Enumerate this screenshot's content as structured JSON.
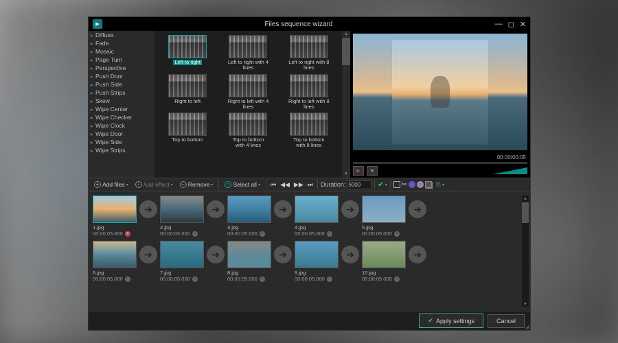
{
  "titlebar": {
    "title": "Files sequence wizard"
  },
  "sidebar": {
    "items": [
      {
        "label": "Diffuse"
      },
      {
        "label": "Fade"
      },
      {
        "label": "Mosaic"
      },
      {
        "label": "Page Turn"
      },
      {
        "label": "Perspective"
      },
      {
        "label": "Push Door"
      },
      {
        "label": "Push Side"
      },
      {
        "label": "Push Strips"
      },
      {
        "label": "Skew"
      },
      {
        "label": "Wipe Center"
      },
      {
        "label": "Wipe Checker"
      },
      {
        "label": "Wipe Clock"
      },
      {
        "label": "Wipe Door"
      },
      {
        "label": "Wipe Side"
      },
      {
        "label": "Wipe Strips"
      }
    ]
  },
  "transitions": [
    {
      "label": "Left to right",
      "highlighted": true
    },
    {
      "label": "Left to right with 4 lines"
    },
    {
      "label": "Left to right with 8 lines"
    },
    {
      "label": "Right to left"
    },
    {
      "label": "Right to left with 4 lines"
    },
    {
      "label": "Right to left with 8 lines"
    },
    {
      "label": "Top to bottom"
    },
    {
      "label": "Top to bottom with 4 lines"
    },
    {
      "label": "Top to bottom with 8 lines"
    }
  ],
  "preview": {
    "timecode": "00:00/00:05"
  },
  "toolbar": {
    "add_files": "Add files",
    "add_effect": "Add effect",
    "remove": "Remove",
    "select_all": "Select all",
    "duration_label": "Duration:",
    "duration_value": "5000"
  },
  "timeline": {
    "items": [
      {
        "name": "1.jpg",
        "time": "00:00:05.000",
        "highlighted": true,
        "close_red": true,
        "thumb": "th1"
      },
      {
        "name": "2.jpg",
        "time": "00:00:05.000",
        "thumb": "th2"
      },
      {
        "name": "3.jpg",
        "time": "00:00:05.000",
        "thumb": "th3"
      },
      {
        "name": "4.jpg",
        "time": "00:00:05.000",
        "thumb": "th4"
      },
      {
        "name": "5.jpg",
        "time": "00:00:05.000",
        "thumb": "th5"
      },
      {
        "name": "6.jpg",
        "time": "00:00:05.000",
        "thumb": "th6"
      },
      {
        "name": "7.jpg",
        "time": "00:00:05.000",
        "thumb": "th7"
      },
      {
        "name": "8.jpg",
        "time": "00:00:05.000",
        "thumb": "th8"
      },
      {
        "name": "9.jpg",
        "time": "00:00:05.000",
        "thumb": "th9"
      },
      {
        "name": "10.jpg",
        "time": "00:00:05.000",
        "thumb": "th10"
      }
    ]
  },
  "footer": {
    "apply": "Apply settings",
    "cancel": "Cancel"
  }
}
